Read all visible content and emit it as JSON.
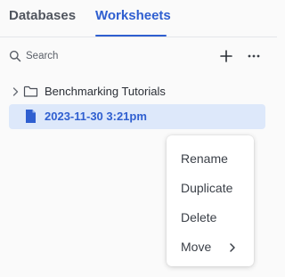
{
  "tabs": [
    {
      "label": "Databases",
      "active": false
    },
    {
      "label": "Worksheets",
      "active": true
    }
  ],
  "colors": {
    "accent": "#2f5fd0",
    "selected_row": "#dde8fa"
  },
  "toolbar": {
    "search": {
      "placeholder": "Search",
      "value": "",
      "icon": "search-icon"
    },
    "add_icon": "plus-icon",
    "more_icon": "ellipsis-icon"
  },
  "tree": {
    "items": [
      {
        "type": "folder",
        "label": "Benchmarking Tutorials",
        "icon": "folder-icon",
        "expanded": false
      },
      {
        "type": "worksheet",
        "label": "2023-11-30 3:21pm",
        "icon": "file-icon",
        "selected": true
      }
    ]
  },
  "context_menu": {
    "items": [
      {
        "label": "Rename"
      },
      {
        "label": "Duplicate"
      },
      {
        "label": "Delete"
      },
      {
        "label": "Move",
        "submenu": true
      }
    ]
  }
}
